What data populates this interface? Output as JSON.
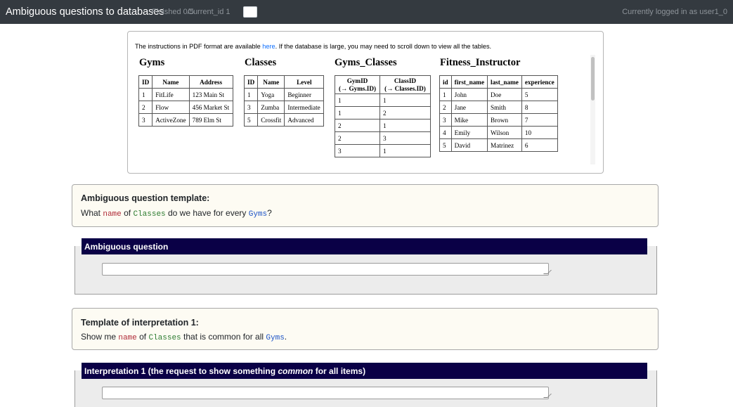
{
  "header": {
    "title": "Ambiguous questions to databases",
    "finished": "Finished 0/5",
    "current_id_label": "Current_id 1",
    "current_id_value": "",
    "user": "Currently logged in as user1_0"
  },
  "db_panel": {
    "instructions_before": "The instructions in PDF format are available ",
    "instructions_link": "here",
    "instructions_after": ". If the database is large, you may need to scroll down to view all the tables."
  },
  "tables": {
    "gyms": {
      "title": "Gyms",
      "columns": [
        "ID",
        "Name",
        "Address"
      ],
      "rows": [
        [
          "1",
          "FitLife",
          "123 Main St"
        ],
        [
          "2",
          "Flow",
          "456 Market St"
        ],
        [
          "3",
          "ActiveZone",
          "789 Elm St"
        ]
      ]
    },
    "classes": {
      "title": "Classes",
      "columns": [
        "ID",
        "Name",
        "Level"
      ],
      "rows": [
        [
          "1",
          "Yoga",
          "Beginner"
        ],
        [
          "3",
          "Zumba",
          "Intermediate"
        ],
        [
          "5",
          "Crossfit",
          "Advanced"
        ]
      ]
    },
    "gyms_classes": {
      "title": "Gyms_Classes",
      "col1_line1": "GymID",
      "col1_line2": "(→ Gyms.ID)",
      "col2_line1": "ClassID",
      "col2_line2": "(→ Classes.ID)",
      "rows": [
        [
          "1",
          "1"
        ],
        [
          "1",
          "2"
        ],
        [
          "2",
          "1"
        ],
        [
          "2",
          "3"
        ],
        [
          "3",
          "1"
        ]
      ]
    },
    "fitness_instructor": {
      "title": "Fitness_Instructor",
      "columns": [
        "id",
        "first_name",
        "last_name",
        "experience"
      ],
      "rows": [
        [
          "1",
          "John",
          "Doe",
          "5"
        ],
        [
          "2",
          "Jane",
          "Smith",
          "8"
        ],
        [
          "3",
          "Mike",
          "Brown",
          "7"
        ],
        [
          "4",
          "Emily",
          "Wilson",
          "10"
        ],
        [
          "5",
          "David",
          "Matrinez",
          "6"
        ]
      ]
    }
  },
  "template_card": {
    "heading": "Ambiguous question template:",
    "t1": "What ",
    "t2": "name",
    "t3": " of ",
    "t4": "Classes",
    "t5": " do we have for every ",
    "t6": "Gyms",
    "t7": "?"
  },
  "ambiguous_question": {
    "legend": "Ambiguous question",
    "value": ""
  },
  "interpretation_card": {
    "heading": "Template of interpretation 1:",
    "t1": "Show me ",
    "t2": "name",
    "t3": " of ",
    "t4": "Classes",
    "t5": " that is common for all ",
    "t6": "Gyms",
    "t7": "."
  },
  "interpretation_1": {
    "legend_before": "Interpretation 1 (the request to show something ",
    "legend_em": "common",
    "legend_after": " for all items)",
    "value": ""
  },
  "colors": {
    "topbar": "#343a40",
    "legend_bg": "#0a0046",
    "card_bg": "#fdfbf3",
    "column_name": "#b02a37",
    "table_name": "#2e7d32",
    "target_table": "#1f55c7"
  }
}
